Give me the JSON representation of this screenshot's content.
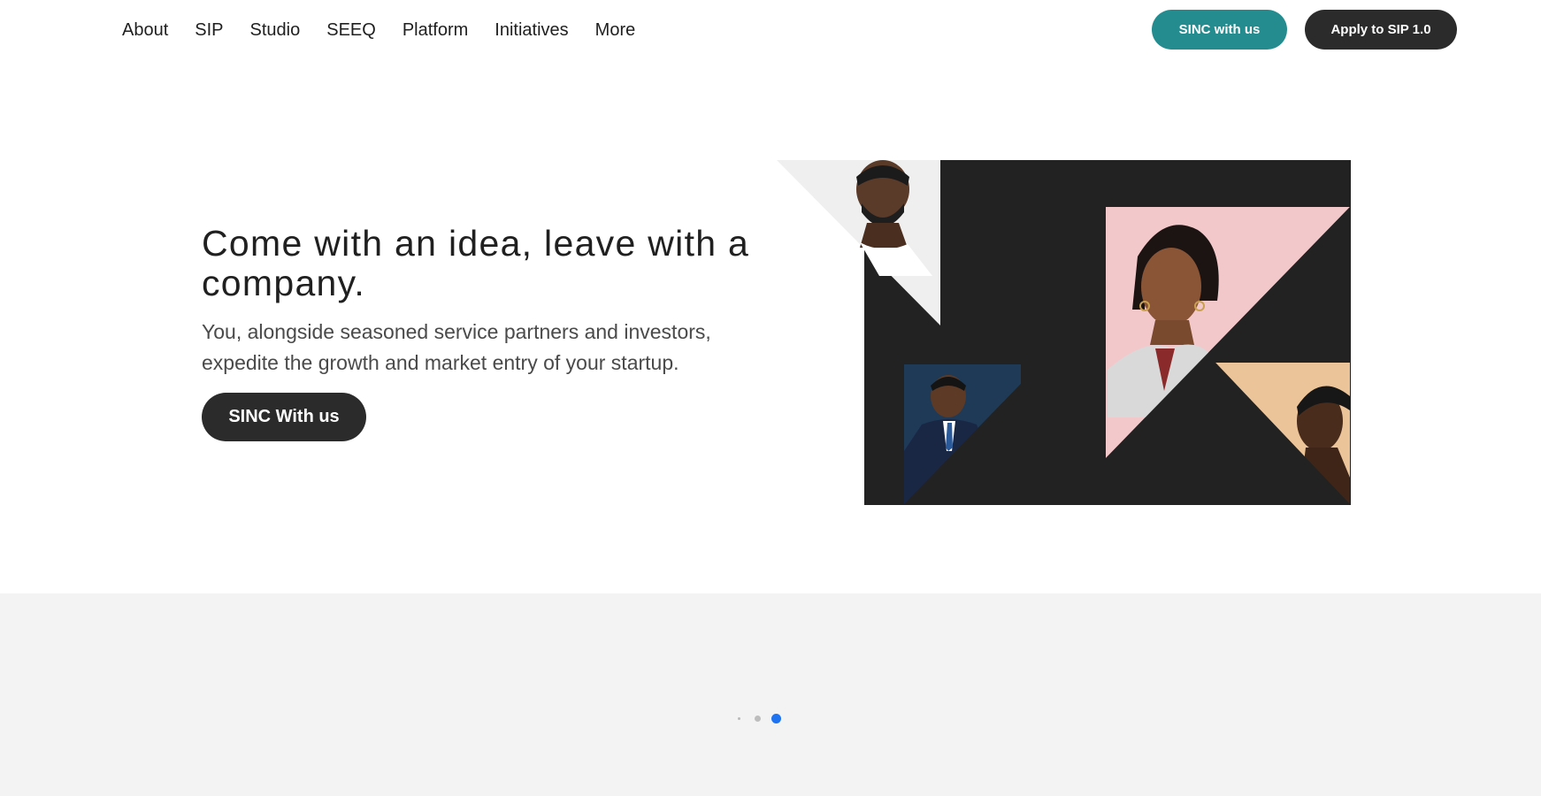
{
  "nav": {
    "links": [
      "About",
      "SIP",
      "Studio",
      "SEEQ",
      "Platform",
      "Initiatives",
      "More"
    ],
    "cta_primary": "SINC with us",
    "cta_secondary": "Apply to SIP 1.0"
  },
  "hero": {
    "title": "Come with an idea, leave with a company.",
    "subtitle": "You, alongside seasoned service partners and investors, expedite the growth and market entry of your startup.",
    "button_label": "SINC With us"
  },
  "carousel": {
    "slide_count": 3,
    "active_index": 2
  },
  "colors": {
    "accent_teal": "#248c8f",
    "dark": "#2b2b2b",
    "pager_active": "#1f73f0",
    "band_bg": "#f3f3f3",
    "art_bg": "#222222",
    "art_pink": "#f2c8cb",
    "art_peach": "#ecc49a"
  }
}
